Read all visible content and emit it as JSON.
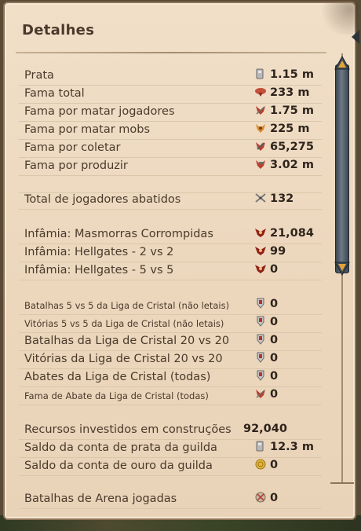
{
  "panel": {
    "title": "Detalhes"
  },
  "rows": [
    {
      "label": "Prata",
      "value": "1.15 m",
      "icon": "silver-icon"
    },
    {
      "label": "Fama total",
      "value": "233 m",
      "icon": "fame-icon"
    },
    {
      "label": "Fama por matar jogadores",
      "value": "1.75 m",
      "icon": "pvp-fame-icon"
    },
    {
      "label": "Fama por matar mobs",
      "value": "225 m",
      "icon": "pve-fame-icon"
    },
    {
      "label": "Fama por coletar",
      "value": "65,275",
      "icon": "gathering-fame-icon"
    },
    {
      "label": "Fama por produzir",
      "value": "3.02 m",
      "icon": "crafting-fame-icon"
    },
    {
      "label": "Total de jogadores abatidos",
      "value": "132",
      "icon": "crossed-swords-icon"
    },
    {
      "label": "Infâmia: Masmorras Corrompidas",
      "value": "21,084",
      "icon": "infamy-icon"
    },
    {
      "label": "Infâmia: Hellgates - 2 vs 2",
      "value": "99",
      "icon": "infamy-icon"
    },
    {
      "label": "Infâmia: Hellgates - 5 vs 5",
      "value": "0",
      "icon": "infamy-icon"
    },
    {
      "label": "Batalhas 5 vs 5 da Liga de Cristal (não letais)",
      "value": "0",
      "icon": "crystal-shield-icon"
    },
    {
      "label": "Vitórias 5 vs 5 da Liga de Cristal (não letais)",
      "value": "0",
      "icon": "crystal-shield-icon"
    },
    {
      "label": "Batalhas da Liga de Cristal 20 vs 20",
      "value": "0",
      "icon": "crystal-shield-icon"
    },
    {
      "label": "Vitórias da Liga de Cristal 20 vs 20",
      "value": "0",
      "icon": "crystal-shield-icon"
    },
    {
      "label": "Abates da Liga de Cristal (todas)",
      "value": "0",
      "icon": "crystal-shield-icon"
    },
    {
      "label": "Fama de Abate da Liga de Cristal (todas)",
      "value": "0",
      "icon": "pvp-fame-icon"
    },
    {
      "label": "Recursos investidos em construções",
      "value": "92,040",
      "icon": ""
    },
    {
      "label": "Saldo da conta de prata da guilda",
      "value": "12.3 m",
      "icon": "silver-icon"
    },
    {
      "label": "Saldo da conta de ouro da guilda",
      "value": "0",
      "icon": "gold-coin-icon"
    },
    {
      "label": "Batalhas de Arena jogadas",
      "value": "0",
      "icon": "arena-icon"
    }
  ],
  "colors": {
    "panel": "#ecd7bd",
    "text": "#4a3a2c",
    "fame_red": "#b8412f",
    "scroll_thumb": "#56636f"
  }
}
